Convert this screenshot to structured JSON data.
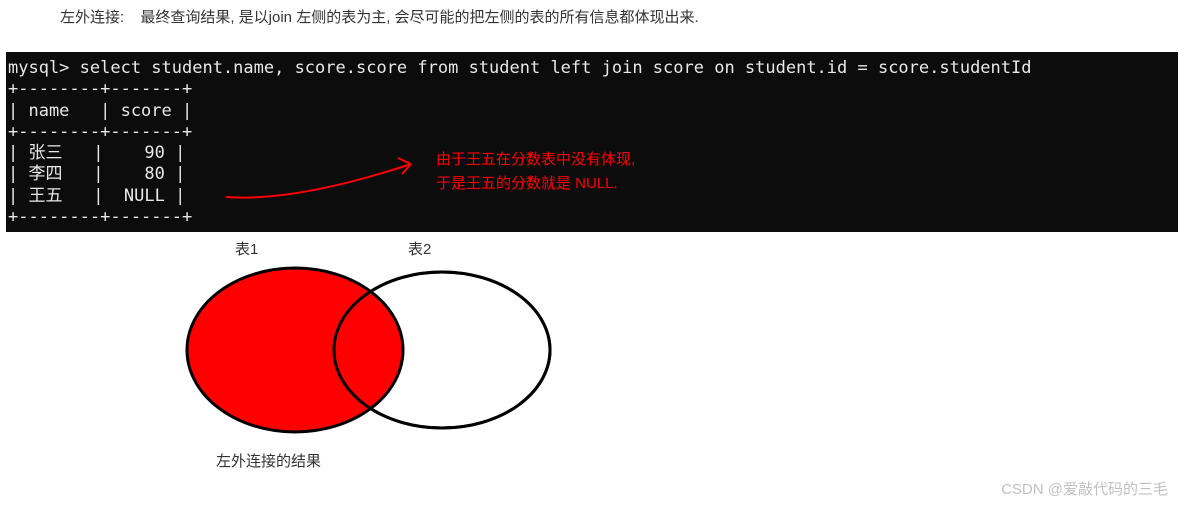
{
  "header": {
    "label": "左外连接:",
    "desc": "最终查询结果, 是以join 左侧的表为主, 会尽可能的把左侧的表的所有信息都体现出来."
  },
  "terminal": {
    "prompt": "mysql> select student.name, score.score from student left join score on student.id = score.studentId",
    "divider_top": "+--------+-------+",
    "header_row": "| name   | score |",
    "divider_mid": "+--------+-------+",
    "rows": [
      {
        "name": "张三",
        "score": "90"
      },
      {
        "name": "李四",
        "score": "80"
      },
      {
        "name": "王五",
        "score": "NULL"
      }
    ],
    "divider_bot": "+--------+-------+"
  },
  "annotation": {
    "line1": "由于王五在分数表中没有体现,",
    "line2": "于是王五的分数就是 NULL."
  },
  "venn": {
    "label1": "表1",
    "label2": "表2",
    "caption": "左外连接的结果"
  },
  "watermark": "CSDN @爱敲代码的三毛",
  "chart_data": {
    "type": "table",
    "title": "student left join score",
    "columns": [
      "name",
      "score"
    ],
    "rows": [
      [
        "张三",
        90
      ],
      [
        "李四",
        80
      ],
      [
        "王五",
        null
      ]
    ]
  }
}
